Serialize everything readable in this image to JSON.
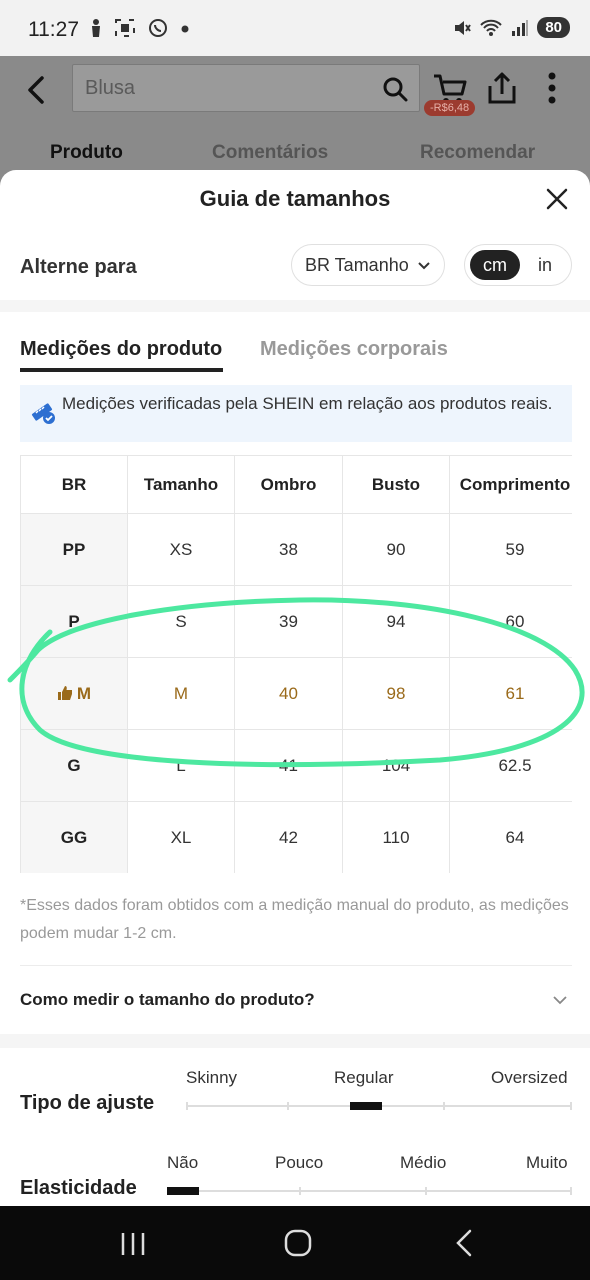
{
  "status_bar": {
    "time": "11:27",
    "battery": "80",
    "left_icons": [
      "person-icon",
      "screenshot-icon",
      "whatsapp-icon",
      "dot-icon"
    ],
    "right_icons": [
      "mute-icon",
      "wifi-icon",
      "signal-icon",
      "battery-icon"
    ]
  },
  "app_header": {
    "search_text": "Blusa",
    "cart_badge": "-R$6,48",
    "tabs": [
      "Produto",
      "Comentários",
      "Recomendar"
    ]
  },
  "sheet": {
    "title": "Guia de tamanhos",
    "switch_label": "Alterne para",
    "size_dropdown": "BR Tamanho",
    "unit_cm": "cm",
    "unit_in": "in",
    "tabs": {
      "product": "Medições do produto",
      "body": "Medições corporais"
    },
    "notice": "Medições verificadas pela SHEIN em relação aos produtos reais.",
    "table": {
      "headers": [
        "BR",
        "Tamanho",
        "Ombro",
        "Busto",
        "Comprimento"
      ],
      "rows": [
        [
          "PP",
          "XS",
          "38",
          "90",
          "59"
        ],
        [
          "P",
          "S",
          "39",
          "94",
          "60"
        ],
        [
          "M",
          "M",
          "40",
          "98",
          "61"
        ],
        [
          "G",
          "L",
          "41",
          "104",
          "62.5"
        ],
        [
          "GG",
          "XL",
          "42",
          "110",
          "64"
        ]
      ],
      "recommended_row": 2
    },
    "footnote": "*Esses dados foram obtidos com a medição manual do produto, as medições podem mudar 1-2 cm.",
    "how_to": "Como medir o tamanho do produto?",
    "fit": {
      "label": "Tipo de ajuste",
      "options": [
        "Skinny",
        "Regular",
        "Oversized"
      ],
      "selected": "Regular"
    },
    "elasticity": {
      "label": "Elasticidade",
      "options": [
        "Não",
        "Pouco",
        "Médio",
        "Muito"
      ],
      "selected": "Não"
    }
  },
  "colors": {
    "recommended": "#9a6a1a",
    "annotation": "#4de8a0",
    "notice_bg": "#eef5fd"
  }
}
